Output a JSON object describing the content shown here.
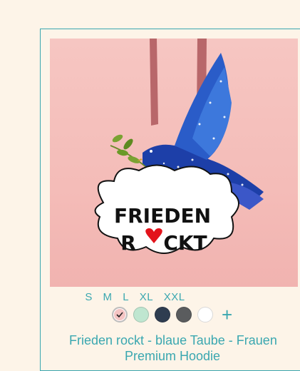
{
  "product": {
    "image_text_line1": "FRIEDEN",
    "image_text_line2a": "R",
    "image_text_line2b": "CKT",
    "title_line1": "Frieden rockt - blaue Taube - Frauen",
    "title_line2": "Premium Hoodie"
  },
  "sizes": [
    "S",
    "M",
    "L",
    "XL",
    "XXL"
  ],
  "colors": [
    {
      "name": "pink",
      "hex": "#f5c4c3",
      "selected": true
    },
    {
      "name": "mint",
      "hex": "#bfe6d0",
      "selected": false
    },
    {
      "name": "navy",
      "hex": "#2f3d50",
      "selected": false
    },
    {
      "name": "dark-grey",
      "hex": "#5a5c5e",
      "selected": false
    },
    {
      "name": "white",
      "hex": "#ffffff",
      "selected": false
    }
  ],
  "add_color_label": "+",
  "accent": "#3aa7b0",
  "card_bg": "#fdf4e8"
}
